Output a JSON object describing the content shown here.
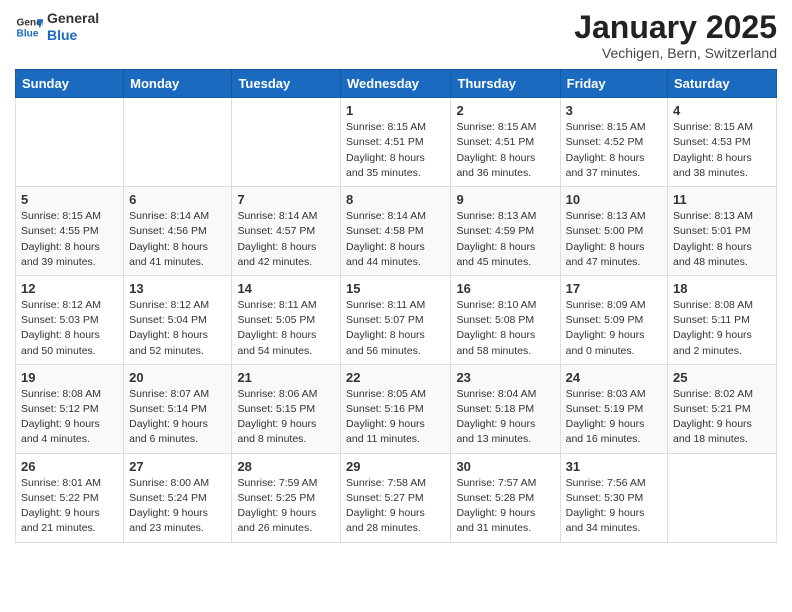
{
  "header": {
    "logo_general": "General",
    "logo_blue": "Blue",
    "month_title": "January 2025",
    "location": "Vechigen, Bern, Switzerland"
  },
  "days_of_week": [
    "Sunday",
    "Monday",
    "Tuesday",
    "Wednesday",
    "Thursday",
    "Friday",
    "Saturday"
  ],
  "weeks": [
    [
      {
        "day": "",
        "info": ""
      },
      {
        "day": "",
        "info": ""
      },
      {
        "day": "",
        "info": ""
      },
      {
        "day": "1",
        "info": "Sunrise: 8:15 AM\nSunset: 4:51 PM\nDaylight: 8 hours\nand 35 minutes."
      },
      {
        "day": "2",
        "info": "Sunrise: 8:15 AM\nSunset: 4:51 PM\nDaylight: 8 hours\nand 36 minutes."
      },
      {
        "day": "3",
        "info": "Sunrise: 8:15 AM\nSunset: 4:52 PM\nDaylight: 8 hours\nand 37 minutes."
      },
      {
        "day": "4",
        "info": "Sunrise: 8:15 AM\nSunset: 4:53 PM\nDaylight: 8 hours\nand 38 minutes."
      }
    ],
    [
      {
        "day": "5",
        "info": "Sunrise: 8:15 AM\nSunset: 4:55 PM\nDaylight: 8 hours\nand 39 minutes."
      },
      {
        "day": "6",
        "info": "Sunrise: 8:14 AM\nSunset: 4:56 PM\nDaylight: 8 hours\nand 41 minutes."
      },
      {
        "day": "7",
        "info": "Sunrise: 8:14 AM\nSunset: 4:57 PM\nDaylight: 8 hours\nand 42 minutes."
      },
      {
        "day": "8",
        "info": "Sunrise: 8:14 AM\nSunset: 4:58 PM\nDaylight: 8 hours\nand 44 minutes."
      },
      {
        "day": "9",
        "info": "Sunrise: 8:13 AM\nSunset: 4:59 PM\nDaylight: 8 hours\nand 45 minutes."
      },
      {
        "day": "10",
        "info": "Sunrise: 8:13 AM\nSunset: 5:00 PM\nDaylight: 8 hours\nand 47 minutes."
      },
      {
        "day": "11",
        "info": "Sunrise: 8:13 AM\nSunset: 5:01 PM\nDaylight: 8 hours\nand 48 minutes."
      }
    ],
    [
      {
        "day": "12",
        "info": "Sunrise: 8:12 AM\nSunset: 5:03 PM\nDaylight: 8 hours\nand 50 minutes."
      },
      {
        "day": "13",
        "info": "Sunrise: 8:12 AM\nSunset: 5:04 PM\nDaylight: 8 hours\nand 52 minutes."
      },
      {
        "day": "14",
        "info": "Sunrise: 8:11 AM\nSunset: 5:05 PM\nDaylight: 8 hours\nand 54 minutes."
      },
      {
        "day": "15",
        "info": "Sunrise: 8:11 AM\nSunset: 5:07 PM\nDaylight: 8 hours\nand 56 minutes."
      },
      {
        "day": "16",
        "info": "Sunrise: 8:10 AM\nSunset: 5:08 PM\nDaylight: 8 hours\nand 58 minutes."
      },
      {
        "day": "17",
        "info": "Sunrise: 8:09 AM\nSunset: 5:09 PM\nDaylight: 9 hours\nand 0 minutes."
      },
      {
        "day": "18",
        "info": "Sunrise: 8:08 AM\nSunset: 5:11 PM\nDaylight: 9 hours\nand 2 minutes."
      }
    ],
    [
      {
        "day": "19",
        "info": "Sunrise: 8:08 AM\nSunset: 5:12 PM\nDaylight: 9 hours\nand 4 minutes."
      },
      {
        "day": "20",
        "info": "Sunrise: 8:07 AM\nSunset: 5:14 PM\nDaylight: 9 hours\nand 6 minutes."
      },
      {
        "day": "21",
        "info": "Sunrise: 8:06 AM\nSunset: 5:15 PM\nDaylight: 9 hours\nand 8 minutes."
      },
      {
        "day": "22",
        "info": "Sunrise: 8:05 AM\nSunset: 5:16 PM\nDaylight: 9 hours\nand 11 minutes."
      },
      {
        "day": "23",
        "info": "Sunrise: 8:04 AM\nSunset: 5:18 PM\nDaylight: 9 hours\nand 13 minutes."
      },
      {
        "day": "24",
        "info": "Sunrise: 8:03 AM\nSunset: 5:19 PM\nDaylight: 9 hours\nand 16 minutes."
      },
      {
        "day": "25",
        "info": "Sunrise: 8:02 AM\nSunset: 5:21 PM\nDaylight: 9 hours\nand 18 minutes."
      }
    ],
    [
      {
        "day": "26",
        "info": "Sunrise: 8:01 AM\nSunset: 5:22 PM\nDaylight: 9 hours\nand 21 minutes."
      },
      {
        "day": "27",
        "info": "Sunrise: 8:00 AM\nSunset: 5:24 PM\nDaylight: 9 hours\nand 23 minutes."
      },
      {
        "day": "28",
        "info": "Sunrise: 7:59 AM\nSunset: 5:25 PM\nDaylight: 9 hours\nand 26 minutes."
      },
      {
        "day": "29",
        "info": "Sunrise: 7:58 AM\nSunset: 5:27 PM\nDaylight: 9 hours\nand 28 minutes."
      },
      {
        "day": "30",
        "info": "Sunrise: 7:57 AM\nSunset: 5:28 PM\nDaylight: 9 hours\nand 31 minutes."
      },
      {
        "day": "31",
        "info": "Sunrise: 7:56 AM\nSunset: 5:30 PM\nDaylight: 9 hours\nand 34 minutes."
      },
      {
        "day": "",
        "info": ""
      }
    ]
  ]
}
